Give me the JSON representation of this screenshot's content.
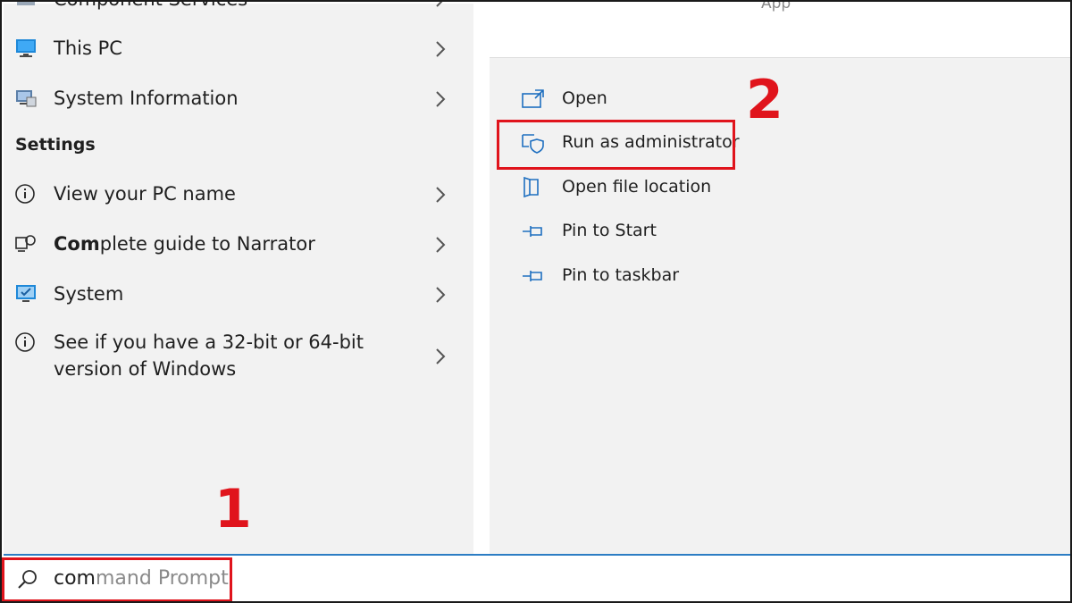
{
  "left_list": {
    "top_cut_label": "Component Services",
    "apps": [
      {
        "label": "This PC",
        "icon": "monitor-icon"
      },
      {
        "label": "System Information",
        "icon": "system-information-icon"
      }
    ],
    "settings_heading": "Settings",
    "settings": [
      {
        "label": "View your PC name",
        "icon": "info-icon"
      },
      {
        "label_bold": "Com",
        "label_rest": "plete guide to Narrator",
        "icon": "narrator-icon"
      },
      {
        "label": "System",
        "icon": "system-monitor-icon"
      },
      {
        "label_line1": "See if you have a 32-bit or 64-bit",
        "label_line2": "version of Windows",
        "icon": "info-icon"
      }
    ]
  },
  "right_panel": {
    "top_cut_label": "App",
    "actions": [
      {
        "label": "Open",
        "icon": "open-icon"
      },
      {
        "label": "Run as administrator",
        "icon": "shield-icon"
      },
      {
        "label": "Open file location",
        "icon": "file-location-icon"
      },
      {
        "label": "Pin to Start",
        "icon": "pin-icon"
      },
      {
        "label": "Pin to taskbar",
        "icon": "pin-icon"
      }
    ]
  },
  "search": {
    "typed": "com",
    "suggestion": "mand Prompt",
    "icon": "search-icon"
  },
  "annotations": {
    "step1": "1",
    "step2": "2",
    "highlight_color": "#e0141c"
  },
  "colors": {
    "accent": "#2c7dc4",
    "panel_bg": "#f2f2f2"
  }
}
